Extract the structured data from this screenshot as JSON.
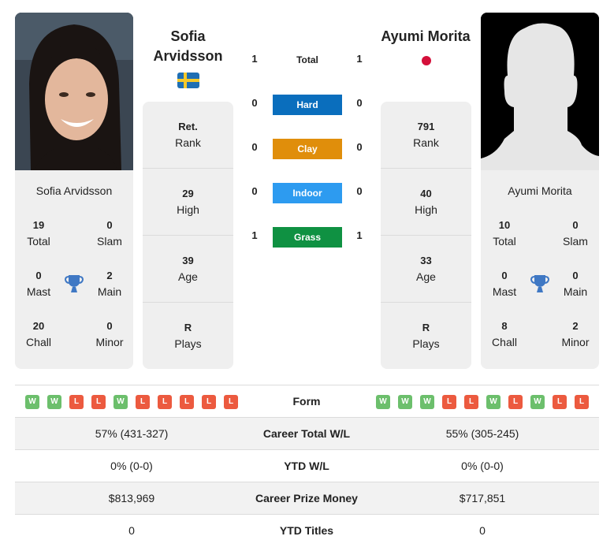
{
  "player_left": {
    "name_heading": "Sofia Arvidsson",
    "name_line1": "Sofia",
    "name_line2": "Arvidsson",
    "card_name": "Sofia Arvidsson",
    "flag": "sweden-flag-icon",
    "titles": {
      "total": {
        "value": "19",
        "label": "Total"
      },
      "slam": {
        "value": "0",
        "label": "Slam"
      },
      "mast": {
        "value": "0",
        "label": "Mast"
      },
      "main": {
        "value": "2",
        "label": "Main"
      },
      "chall": {
        "value": "20",
        "label": "Chall"
      },
      "minor": {
        "value": "0",
        "label": "Minor"
      }
    },
    "rank": {
      "value": "Ret.",
      "label": "Rank"
    },
    "high": {
      "value": "29",
      "label": "High"
    },
    "age": {
      "value": "39",
      "label": "Age"
    },
    "plays": {
      "value": "R",
      "label": "Plays"
    },
    "form": [
      "W",
      "W",
      "L",
      "L",
      "W",
      "L",
      "L",
      "L",
      "L",
      "L"
    ]
  },
  "player_right": {
    "name_heading": "Ayumi Morita",
    "card_name": "Ayumi Morita",
    "flag": "japan-flag-icon",
    "titles": {
      "total": {
        "value": "10",
        "label": "Total"
      },
      "slam": {
        "value": "0",
        "label": "Slam"
      },
      "mast": {
        "value": "0",
        "label": "Mast"
      },
      "main": {
        "value": "0",
        "label": "Main"
      },
      "chall": {
        "value": "8",
        "label": "Chall"
      },
      "minor": {
        "value": "2",
        "label": "Minor"
      }
    },
    "rank": {
      "value": "791",
      "label": "Rank"
    },
    "high": {
      "value": "40",
      "label": "High"
    },
    "age": {
      "value": "33",
      "label": "Age"
    },
    "plays": {
      "value": "R",
      "label": "Plays"
    },
    "form": [
      "W",
      "W",
      "W",
      "L",
      "L",
      "W",
      "L",
      "W",
      "L",
      "L"
    ]
  },
  "h2h": {
    "total": {
      "label": "Total",
      "left": "1",
      "right": "1"
    },
    "surfaces": [
      {
        "label": "Hard",
        "left": "0",
        "right": "0",
        "color": "#0a6ebd"
      },
      {
        "label": "Clay",
        "left": "0",
        "right": "0",
        "color": "#e08e0b"
      },
      {
        "label": "Indoor",
        "left": "0",
        "right": "0",
        "color": "#2d9bf0"
      },
      {
        "label": "Grass",
        "left": "1",
        "right": "1",
        "color": "#0f9142"
      }
    ]
  },
  "form_label": "Form",
  "stats": [
    {
      "label": "Career Total W/L",
      "left": "57% (431-327)",
      "right": "55% (305-245)"
    },
    {
      "label": "YTD W/L",
      "left": "0% (0-0)",
      "right": "0% (0-0)"
    },
    {
      "label": "Career Prize Money",
      "left": "$813,969",
      "right": "$717,851"
    },
    {
      "label": "YTD Titles",
      "left": "0",
      "right": "0"
    }
  ]
}
